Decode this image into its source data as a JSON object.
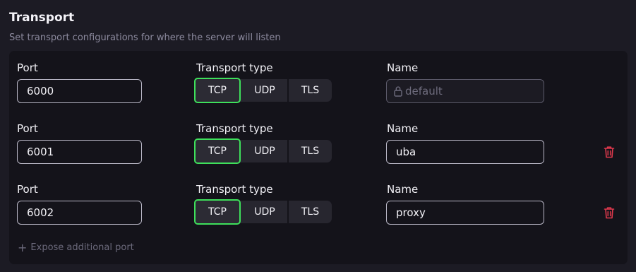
{
  "section": {
    "title": "Transport",
    "subtitle": "Set transport configurations for where the server will listen"
  },
  "labels": {
    "port": "Port",
    "transport_type": "Transport type",
    "name": "Name"
  },
  "transport_options": [
    "TCP",
    "UDP",
    "TLS"
  ],
  "rows": [
    {
      "port": "6000",
      "transport": "TCP",
      "name": "",
      "name_placeholder": "default",
      "name_locked": true,
      "deletable": false
    },
    {
      "port": "6001",
      "transport": "TCP",
      "name": "uba",
      "name_locked": false,
      "deletable": true
    },
    {
      "port": "6002",
      "transport": "TCP",
      "name": "proxy",
      "name_locked": false,
      "deletable": true
    }
  ],
  "expose_button": "Expose additional port",
  "colors": {
    "accent": "#3ee05b",
    "danger": "#e0394d",
    "background": "#1c1b24",
    "panel": "#14131a"
  },
  "icons": {
    "lock": "lock-icon",
    "trash": "trash-icon",
    "plus": "plus-icon"
  }
}
